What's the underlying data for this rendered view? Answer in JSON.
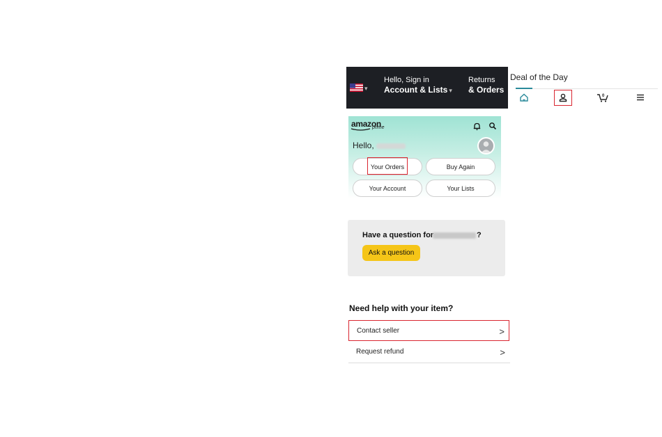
{
  "header": {
    "flag_icon": "us-flag-icon",
    "greeting": "Hello, Sign in",
    "account_label": "Account & Lists",
    "returns_label": "Returns",
    "orders_label": "& Orders"
  },
  "deal_of_the_day": "Deal of the Day",
  "bottom_nav": {
    "items": [
      {
        "icon": "home-icon"
      },
      {
        "icon": "account-icon",
        "highlighted": true
      },
      {
        "icon": "cart-icon",
        "badge": "0"
      },
      {
        "icon": "menu-icon"
      }
    ],
    "accent_color": "#2a8a9a"
  },
  "app_card": {
    "logo": "amazon",
    "logo_sub": "prime",
    "greeting": "Hello,",
    "buttons": [
      "Your Orders",
      "Buy Again",
      "Your Account",
      "Your Lists"
    ]
  },
  "question_card": {
    "text": "Have a question for",
    "suffix": "?",
    "button": "Ask a question",
    "button_color": "#f5c518"
  },
  "help_section": {
    "title": "Need help with your item?",
    "rows": [
      "Contact seller",
      "Request refund"
    ]
  },
  "highlight_color": "#d9252f"
}
